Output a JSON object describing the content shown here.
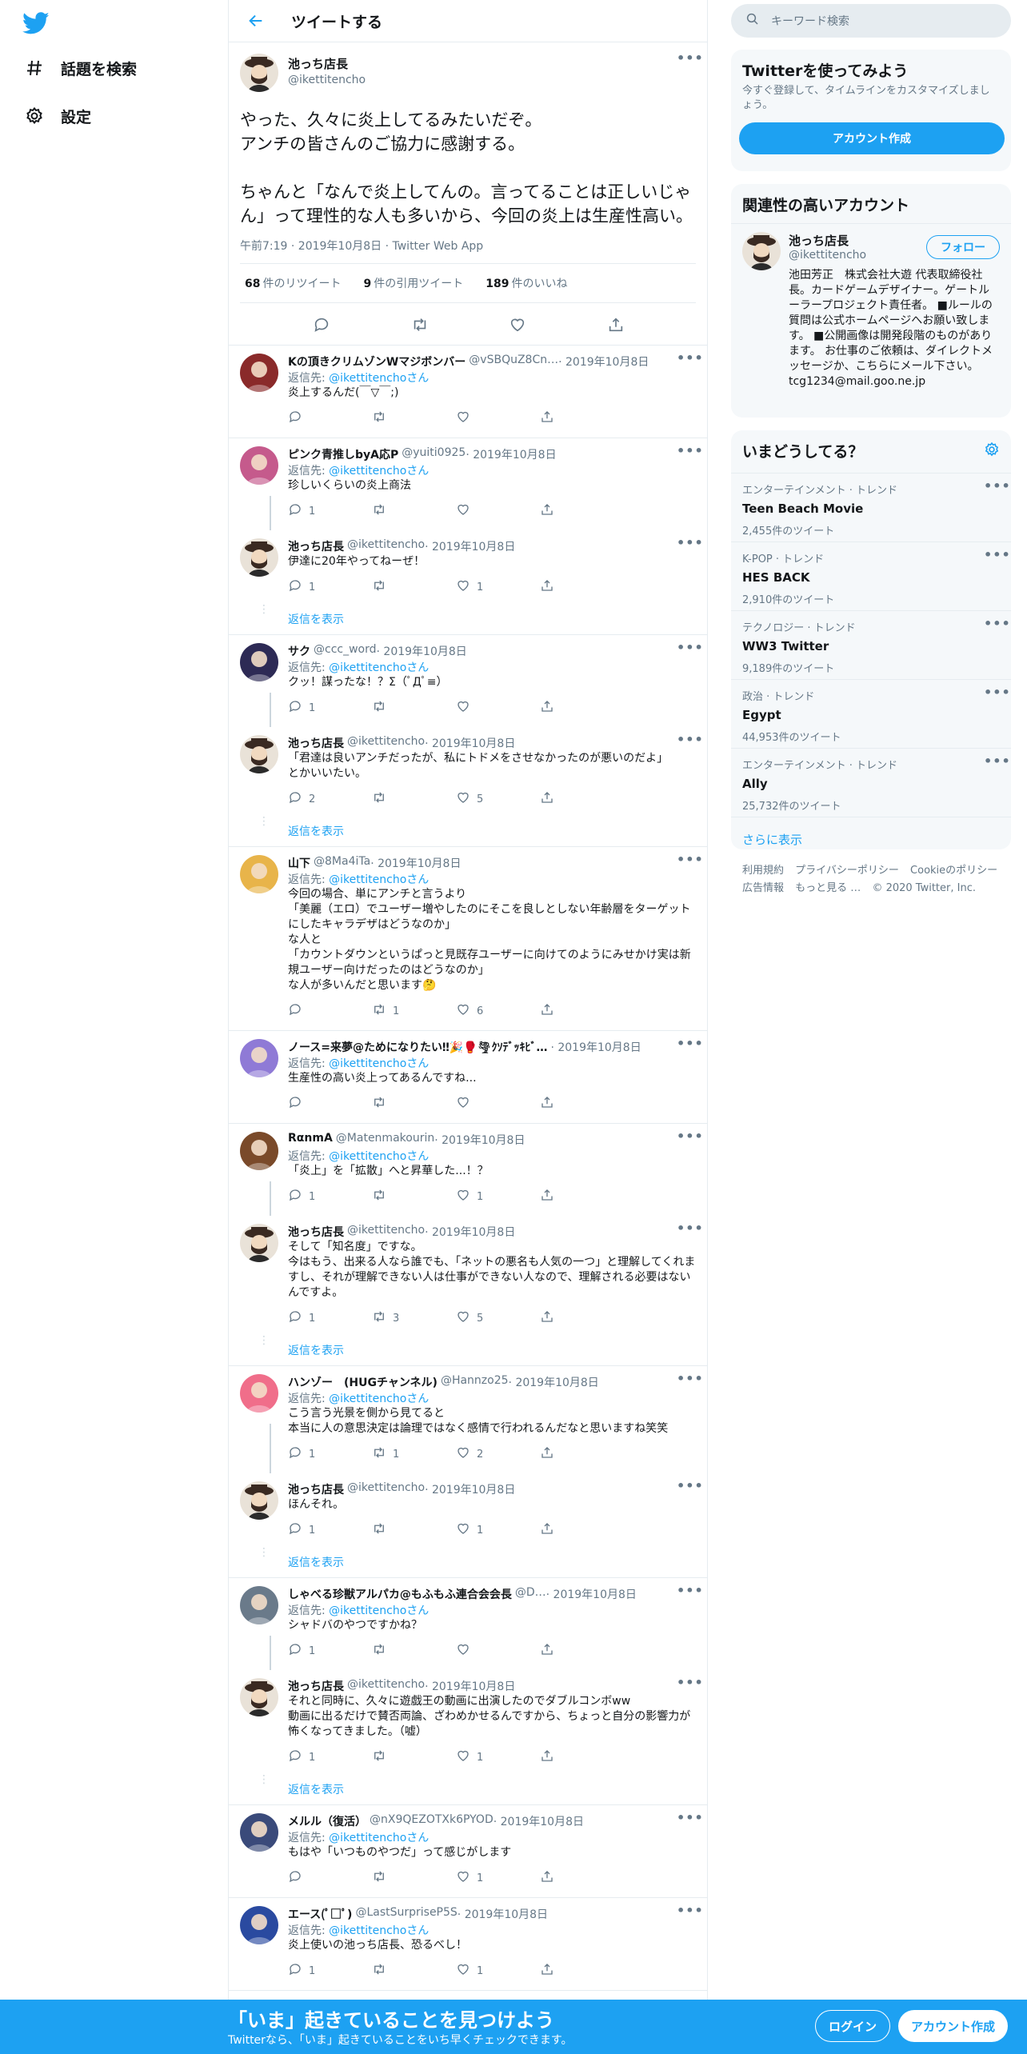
{
  "nav": {
    "explore": "話題を検索",
    "settings": "設定"
  },
  "header": {
    "title": "ツイートする"
  },
  "focal": {
    "name": "池っち店長",
    "handle": "@ikettitencho",
    "text": "やった、久々に炎上してるみたいだぞ。\nアンチの皆さんのご協力に感謝する。\n\nちゃんと「なんで炎上してんの。言ってることは正しいじゃん」って理性的な人も多いから、今回の炎上は生産性高い。",
    "meta": "午前7:19 · 2019年10月8日 · Twitter Web App",
    "retweets_num": "68",
    "retweets_label": "件のリツイート",
    "quotes_num": "9",
    "quotes_label": "件の引用ツイート",
    "likes_num": "189",
    "likes_label": "件のいいね"
  },
  "replying_label": "返信先: ",
  "replying_handle": "@ikettitencho",
  "replying_suffix": "さん",
  "show_replies": "返信を表示",
  "replies": [
    {
      "name": "Kの頂きクリムゾンWマジボンバー",
      "handle": "@vSBQuZ8Cn…",
      "date": " · 2019年10月8日",
      "text": "炎上するんだ(￣▽￣;)",
      "c": "",
      "r": "",
      "l": "",
      "to": true
    },
    {
      "name": "ピンク青推しbyA応P",
      "handle": "@yuiti0925",
      "date": " · 2019年10月8日",
      "text": "珍しいくらいの炎上商法",
      "c": "1",
      "r": "",
      "l": "",
      "to": true
    },
    {
      "name": "池っち店長",
      "handle": "@ikettitencho",
      "date": " · 2019年10月8日",
      "text": "伊達に20年やってねーぜ！",
      "c": "1",
      "r": "",
      "l": "1",
      "to": false
    },
    {
      "name": "サク",
      "handle": "@ccc_word",
      "date": " · 2019年10月8日",
      "text": "クッ！謀ったな！？Σ（ﾟДﾟ≡）",
      "c": "1",
      "r": "",
      "l": "",
      "to": true
    },
    {
      "name": "池っち店長",
      "handle": "@ikettitencho",
      "date": " · 2019年10月8日",
      "text": "「君達は良いアンチだったが、私にトドメをさせなかったのが悪いのだよ」\nとかいいたい。",
      "c": "2",
      "r": "",
      "l": "5",
      "to": false
    },
    {
      "name": "山下",
      "handle": "@8Ma4iTa",
      "date": " · 2019年10月8日",
      "text": "今回の場合、単にアンチと言うより\n「美麗（エロ）でユーザー増やしたのにそこを良しとしない年齢層をターゲットにしたキャラデザはどうなのか」\nな人と\n「カウントダウンというぱっと見既存ユーザーに向けてのようにみせかけ実は新規ユーザー向けだったのはどうなのか」\nな人が多いんだと思います🤔",
      "c": "",
      "r": "1",
      "l": "6",
      "to": true
    },
    {
      "name": "ノース=来夢@ためになりたい‼🎉🥊🌪ｸｿﾃﾞｯｷﾋﾞ…",
      "handle": "",
      "date": " · 2019年10月8日",
      "text": "生産性の高い炎上ってあるんですね...",
      "c": "",
      "r": "",
      "l": "",
      "to": true
    },
    {
      "name": "RαnmA",
      "handle": "@Matenmakourin",
      "date": " · 2019年10月8日",
      "text": "「炎上」を「拡散」へと昇華した...！？",
      "c": "1",
      "r": "",
      "l": "1",
      "to": true
    },
    {
      "name": "池っち店長",
      "handle": "@ikettitencho",
      "date": " · 2019年10月8日",
      "text": "そして「知名度」ですな。\n今はもう、出来る人なら誰でも、「ネットの悪名も人気の一つ」と理解してくれますし、それが理解できない人は仕事ができない人なので、理解される必要はないんですよ。",
      "c": "1",
      "r": "3",
      "l": "5",
      "to": false
    },
    {
      "name": "ハンゾー　(HUGチャンネル)",
      "handle": "@Hannzo25",
      "date": " · 2019年10月8日",
      "text": "こう言う光景を側から見てると\n本当に人の意思決定は論理ではなく感情で行われるんだなと思いますね笑笑",
      "c": "1",
      "r": "1",
      "l": "2",
      "to": true
    },
    {
      "name": "池っち店長",
      "handle": "@ikettitencho",
      "date": " · 2019年10月8日",
      "text": "ほんそれ。",
      "c": "1",
      "r": "",
      "l": "1",
      "to": false
    },
    {
      "name": "しゃべる珍獣アルパカ@もふもふ連合会会長",
      "handle": "@D…",
      "date": " · 2019年10月8日",
      "text": "シャドバのやつですかね？",
      "c": "1",
      "r": "",
      "l": "",
      "to": true
    },
    {
      "name": "池っち店長",
      "handle": "@ikettitencho",
      "date": " · 2019年10月8日",
      "text": "それと同時に、久々に遊戯王の動画に出演したのでダブルコンボww\n動画に出るだけで賛否両論、ざわめかせるんですから、ちょっと自分の影響力が怖くなってきました。（嘘）",
      "c": "1",
      "r": "",
      "l": "1",
      "to": false
    },
    {
      "name": "メルル（復活）",
      "handle": "@nX9QEZOTXk6PYOD",
      "date": " · 2019年10月8日",
      "text": "もはや「いつものやつだ」って感じがします",
      "c": "",
      "r": "",
      "l": "1",
      "to": true
    },
    {
      "name": "エース(ﾟ□ﾟ)",
      "handle": "@LastSurpriseP5S",
      "date": " · 2019年10月8日",
      "text": "炎上使いの池っち店長、恐るべし！",
      "c": "1",
      "r": "",
      "l": "1",
      "to": true
    }
  ],
  "search": {
    "placeholder": "キーワード検索"
  },
  "signup_card": {
    "title": "Twitterを使ってみよう",
    "text": "今すぐ登録して、タイムラインをカスタマイズしましょう。",
    "button": "アカウント作成"
  },
  "relevant": {
    "title": "関連性の高いアカウント",
    "name": "池っち店長",
    "handle": "@ikettitencho",
    "follow": "フォロー",
    "bio": "池田芳正　株式会社大遊 代表取締役社長。カードゲームデザイナー。ゲートルーラープロジェクト責任者。 ■ルールの質問は公式ホームページへお願い致します。 ■公開画像は開発段階のものがあります。 お仕事のご依頼は、ダイレクトメッセージか、こちらにメール下さい。\ntcg1234@mail.goo.ne.jp"
  },
  "trends": {
    "title": "いまどうしてる？",
    "items": [
      {
        "category": "エンターテインメント · トレンド",
        "name": "Teen Beach Movie",
        "count": "2,455件のツイート"
      },
      {
        "category": "K-POP · トレンド",
        "name": "HES BACK",
        "count": "2,910件のツイート"
      },
      {
        "category": "テクノロジー · トレンド",
        "name": "WW3 Twitter",
        "count": "9,189件のツイート"
      },
      {
        "category": "政治 · トレンド",
        "name": "Egypt",
        "count": "44,953件のツイート"
      },
      {
        "category": "エンターテインメント · トレンド",
        "name": "Ally",
        "count": "25,732件のツイート"
      }
    ],
    "show_more": "さらに表示"
  },
  "footer": {
    "terms": "利用規約",
    "privacy": "プライバシーポリシー",
    "cookie": "Cookieのポリシー",
    "ads": "広告情報",
    "more": "もっと見る …",
    "copyright": "© 2020 Twitter, Inc."
  },
  "bottom": {
    "title": "「いま」起きていることを見つけよう",
    "subtitle": "Twitterなら、「いま」起きていることをいち早くチェックできます。",
    "login": "ログイン",
    "signup": "アカウント作成"
  },
  "colors": {
    "accent": "#1da1f2",
    "text": "#14171a",
    "muted": "#657786",
    "border": "#e6ecf0"
  }
}
